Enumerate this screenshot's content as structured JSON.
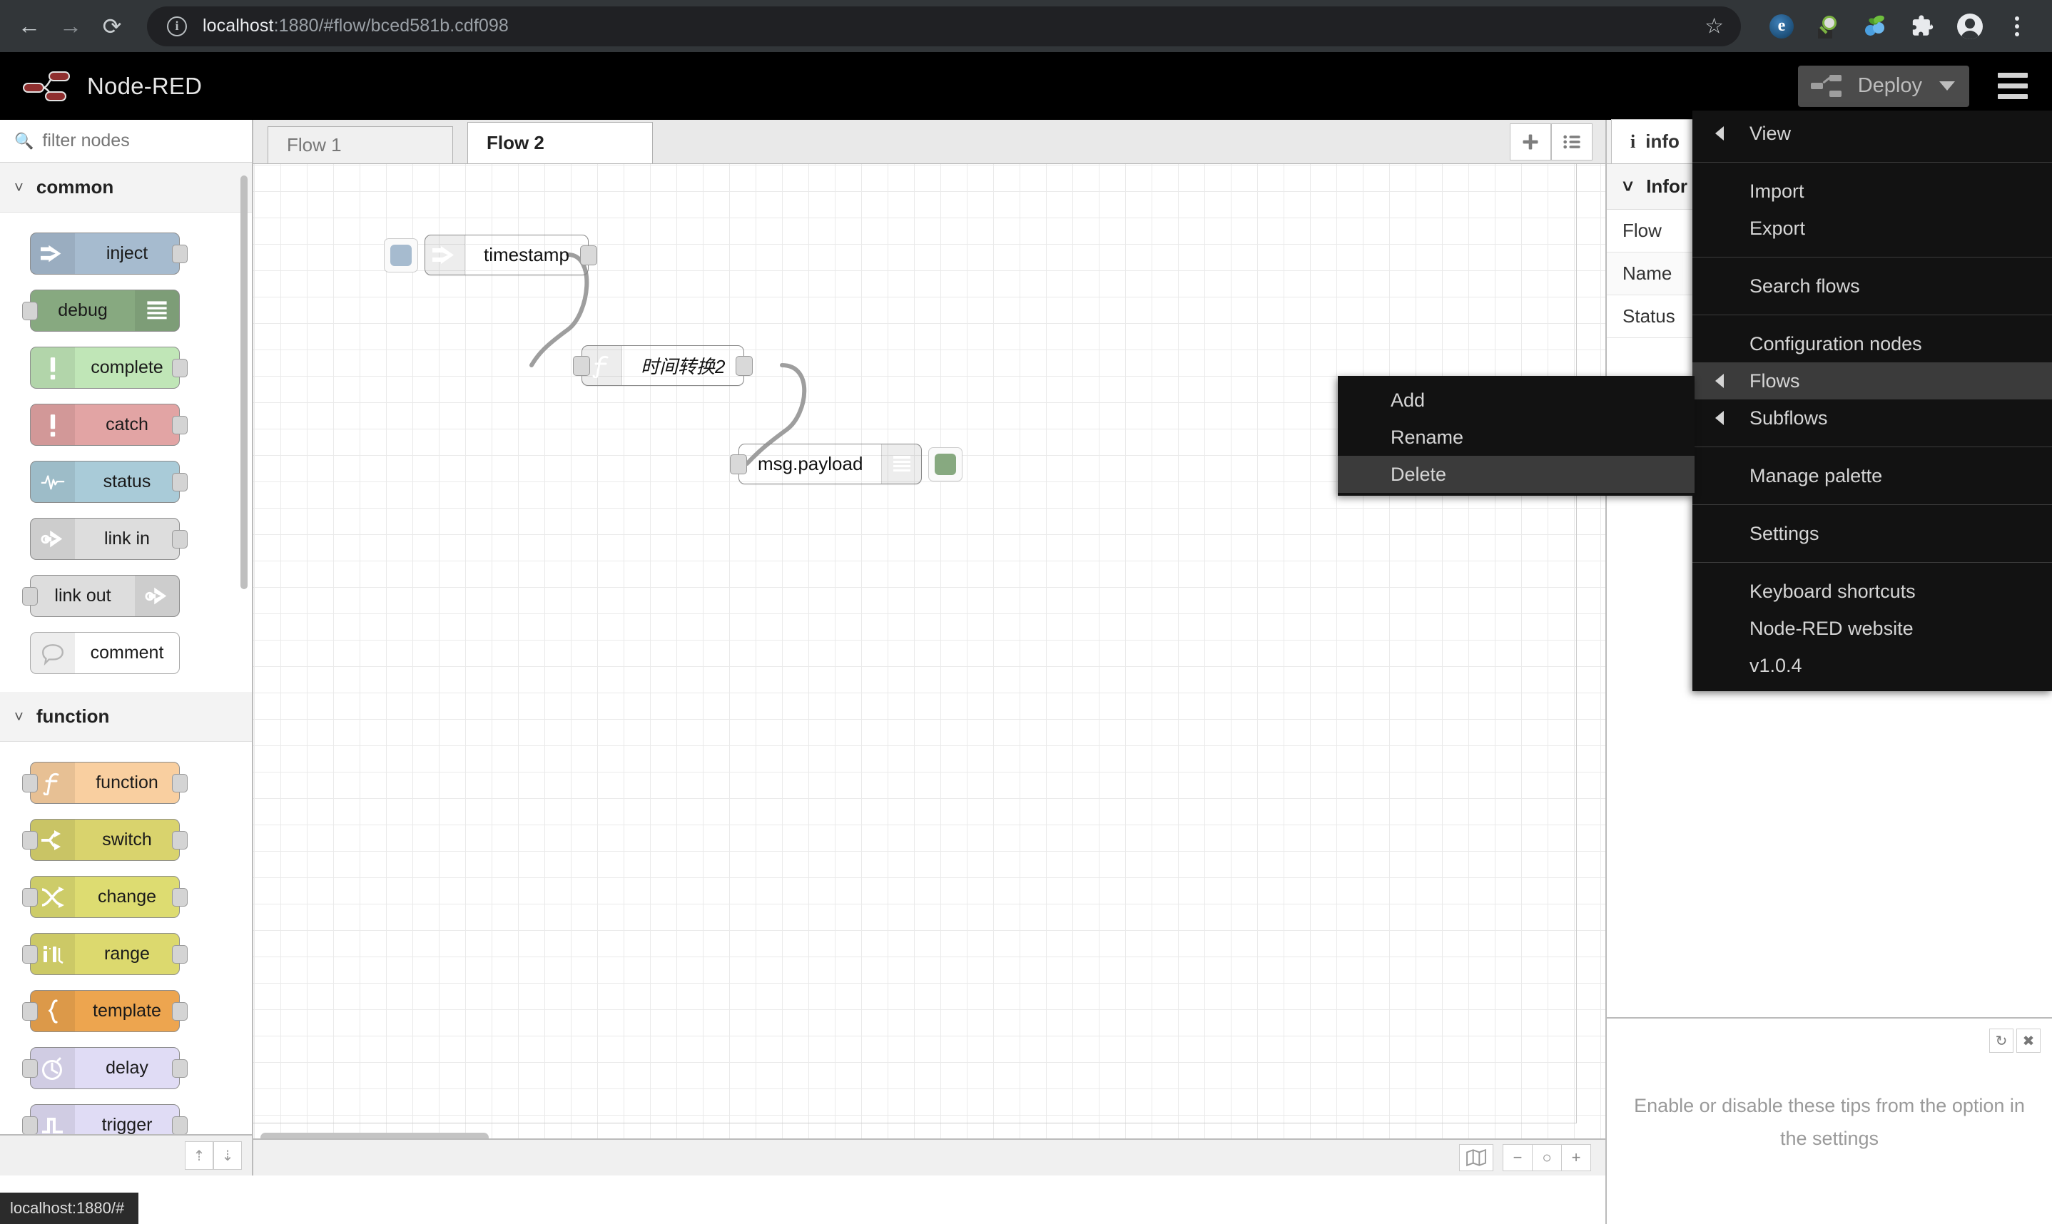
{
  "browser": {
    "back_icon": "back-arrow-icon",
    "forward_icon": "forward-arrow-icon",
    "reload_icon": "reload-icon",
    "site_info_icon": "info-circle-icon",
    "url_host": "localhost",
    "url_rest": ":1880/#flow/bced581b.cdf098",
    "star_icon": "bookmark-star-icon",
    "extensions": [
      "evernote-extension-icon",
      "search-magnifier-extension-icon",
      "bluejeans-extension-icon",
      "puzzle-extensions-icon",
      "profile-avatar-icon",
      "chrome-menu-kebab-icon"
    ],
    "status_tip": "localhost:1880/#"
  },
  "header": {
    "logo_icon": "node-red-logo-icon",
    "title": "Node-RED",
    "deploy_label": "Deploy",
    "deploy_icon": "deploy-nodes-icon",
    "deploy_caret_icon": "chevron-down-icon",
    "menu_icon": "hamburger-menu-icon"
  },
  "palette": {
    "search_placeholder": "filter nodes",
    "search_value": "",
    "search_icon": "search-icon",
    "categories": [
      {
        "name": "common",
        "chevron_icon": "chevron-down-icon",
        "nodes": [
          {
            "label": "inject",
            "icon": "inject-arrow-icon",
            "fill": "#a6bbcf",
            "in": false,
            "out": true,
            "icon_side": "left"
          },
          {
            "label": "debug",
            "icon": "debug-lines-icon",
            "fill": "#87a980",
            "in": true,
            "out": false,
            "icon_side": "right"
          },
          {
            "label": "complete",
            "icon": "exclamation-icon",
            "fill": "#c0e6b7",
            "in": false,
            "out": true,
            "icon_side": "left"
          },
          {
            "label": "catch",
            "icon": "exclamation-icon",
            "fill": "#e2a4a4",
            "in": false,
            "out": true,
            "icon_side": "left"
          },
          {
            "label": "status",
            "icon": "pulse-wave-icon",
            "fill": "#a9cbd8",
            "in": false,
            "out": true,
            "icon_side": "left"
          },
          {
            "label": "link in",
            "icon": "link-arrow-icon",
            "fill": "#dddddd",
            "in": false,
            "out": true,
            "icon_side": "left"
          },
          {
            "label": "link out",
            "icon": "link-arrow-icon",
            "fill": "#dddddd",
            "in": true,
            "out": false,
            "icon_side": "right"
          },
          {
            "label": "comment",
            "icon": "comment-bubble-icon",
            "fill": "#ffffff",
            "in": false,
            "out": false,
            "icon_side": "left"
          }
        ]
      },
      {
        "name": "function",
        "chevron_icon": "chevron-down-icon",
        "nodes": [
          {
            "label": "function",
            "icon": "function-f-icon",
            "fill": "#f9cfa0",
            "in": true,
            "out": true,
            "icon_side": "left"
          },
          {
            "label": "switch",
            "icon": "switch-branch-icon",
            "fill": "#d9d36d",
            "in": true,
            "out": true,
            "icon_side": "left"
          },
          {
            "label": "change",
            "icon": "change-swap-icon",
            "fill": "#dddc71",
            "in": true,
            "out": true,
            "icon_side": "left"
          },
          {
            "label": "range",
            "icon": "range-icon",
            "fill": "#dcd96e",
            "in": true,
            "out": true,
            "icon_side": "left"
          },
          {
            "label": "template",
            "icon": "brace-icon",
            "fill": "#eda54f",
            "in": true,
            "out": true,
            "icon_side": "left"
          },
          {
            "label": "delay",
            "icon": "stopwatch-icon",
            "fill": "#e0dcf5",
            "in": true,
            "out": true,
            "icon_side": "left"
          },
          {
            "label": "trigger",
            "icon": "pulse-square-icon",
            "fill": "#e0dcf5",
            "in": true,
            "out": true,
            "icon_side": "left"
          }
        ]
      }
    ],
    "footer_up_icon": "collapse-all-icon",
    "footer_down_icon": "expand-all-icon"
  },
  "workspace": {
    "tabs": [
      {
        "label": "Flow 1",
        "active": false
      },
      {
        "label": "Flow 2",
        "active": true
      }
    ],
    "add_tab_icon": "plus-icon",
    "list_tabs_icon": "list-icon",
    "nodes": [
      {
        "id": "timestamp",
        "label": "timestamp",
        "icon": "inject-arrow-icon",
        "fill": "#a6bbcf",
        "italic": false
      },
      {
        "id": "fn",
        "label": "时间转换2",
        "icon": "function-f-icon",
        "fill": "#f9cfa0",
        "italic": true
      },
      {
        "id": "debug",
        "label": "msg.payload",
        "icon": "debug-lines-icon",
        "fill": "#87a980",
        "italic": false
      }
    ],
    "footer": {
      "map_icon": "navigator-map-icon",
      "zoom_out_label": "−",
      "zoom_reset_label": "○",
      "zoom_in_label": "+"
    }
  },
  "sidebar": {
    "tab_label": "info",
    "tab_icon": "info-i-icon",
    "section_title": "Infor",
    "section_chevron_icon": "chevron-down-icon",
    "rows": [
      "Flow",
      "Name",
      "Status"
    ],
    "tips": {
      "refresh_icon": "refresh-icon",
      "close_icon": "close-x-icon",
      "text": "Enable or disable these tips from the option in the settings"
    }
  },
  "main_menu": {
    "items": [
      {
        "label": "View",
        "submenu": true,
        "selected": false,
        "sep_after": true
      },
      {
        "label": "Import",
        "submenu": false,
        "selected": false,
        "sep_after": false
      },
      {
        "label": "Export",
        "submenu": false,
        "selected": false,
        "sep_after": true
      },
      {
        "label": "Search flows",
        "submenu": false,
        "selected": false,
        "sep_after": true
      },
      {
        "label": "Configuration nodes",
        "submenu": false,
        "selected": false,
        "sep_after": false
      },
      {
        "label": "Flows",
        "submenu": true,
        "selected": true,
        "sep_after": false
      },
      {
        "label": "Subflows",
        "submenu": true,
        "selected": false,
        "sep_after": true
      },
      {
        "label": "Manage palette",
        "submenu": false,
        "selected": false,
        "sep_after": true
      },
      {
        "label": "Settings",
        "submenu": false,
        "selected": false,
        "sep_after": true
      },
      {
        "label": "Keyboard shortcuts",
        "submenu": false,
        "selected": false,
        "sep_after": false
      },
      {
        "label": "Node-RED website",
        "submenu": false,
        "selected": false,
        "sep_after": false
      },
      {
        "label": "v1.0.4",
        "submenu": false,
        "selected": false,
        "sep_after": false
      }
    ]
  },
  "flows_submenu": {
    "items": [
      {
        "label": "Add",
        "selected": false
      },
      {
        "label": "Rename",
        "selected": false
      },
      {
        "label": "Delete",
        "selected": true
      }
    ]
  }
}
